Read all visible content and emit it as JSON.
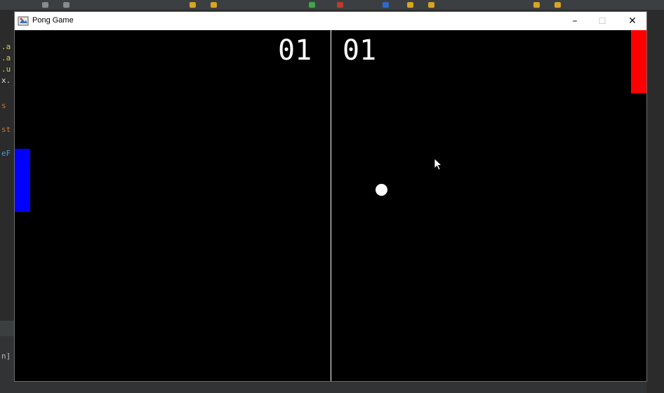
{
  "window": {
    "title": "Pong Game",
    "minimize_glyph": "–",
    "maximize_glyph": "☐",
    "close_glyph": "✕"
  },
  "game": {
    "score_left": "01",
    "score_right": "01",
    "colors": {
      "left_paddle": "#0000ff",
      "right_paddle": "#ff0000",
      "ball": "#ffffff",
      "background": "#000000",
      "center_line": "#ffffff"
    }
  },
  "ide_fragments": {
    "lines": [
      ".a",
      ".a",
      ".u",
      "x.",
      "s",
      "st",
      "eF"
    ],
    "bottom_text": "n]"
  }
}
